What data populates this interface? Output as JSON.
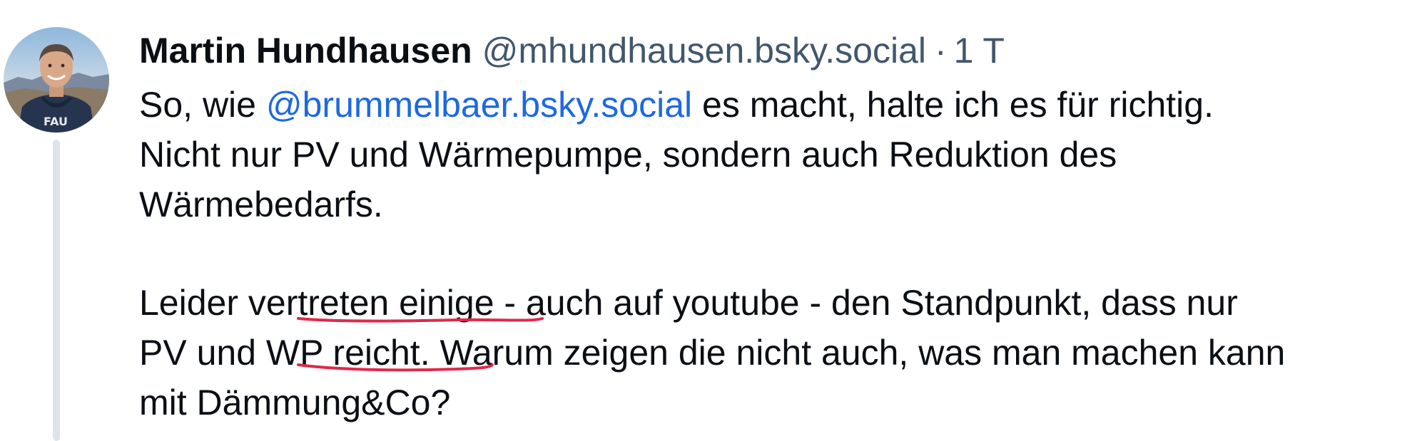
{
  "post": {
    "author": {
      "name": "Martin Hundhausen",
      "handle": "@mhundhausen.bsky.social",
      "separator": "·",
      "time": "1 T"
    },
    "body": {
      "line1_prefix": "So, wie ",
      "mention": "@brummelbaer.bsky.social",
      "line1_suffix": " es macht, halte ich es für richtig.",
      "line2": "Nicht nur PV und Wärmepumpe, sondern auch Reduktion des",
      "line3": "Wärmebedarfs.",
      "line4": "Leider vertreten einige - auch auf youtube - den Standpunkt, dass nur",
      "line5": "PV und WP reicht. Warum zeigen die nicht auch, was man machen kann",
      "line6": "mit Dämmung&Co?"
    },
    "avatar_icon": "person-photo-icon",
    "annotation_color": "#e0284a"
  }
}
